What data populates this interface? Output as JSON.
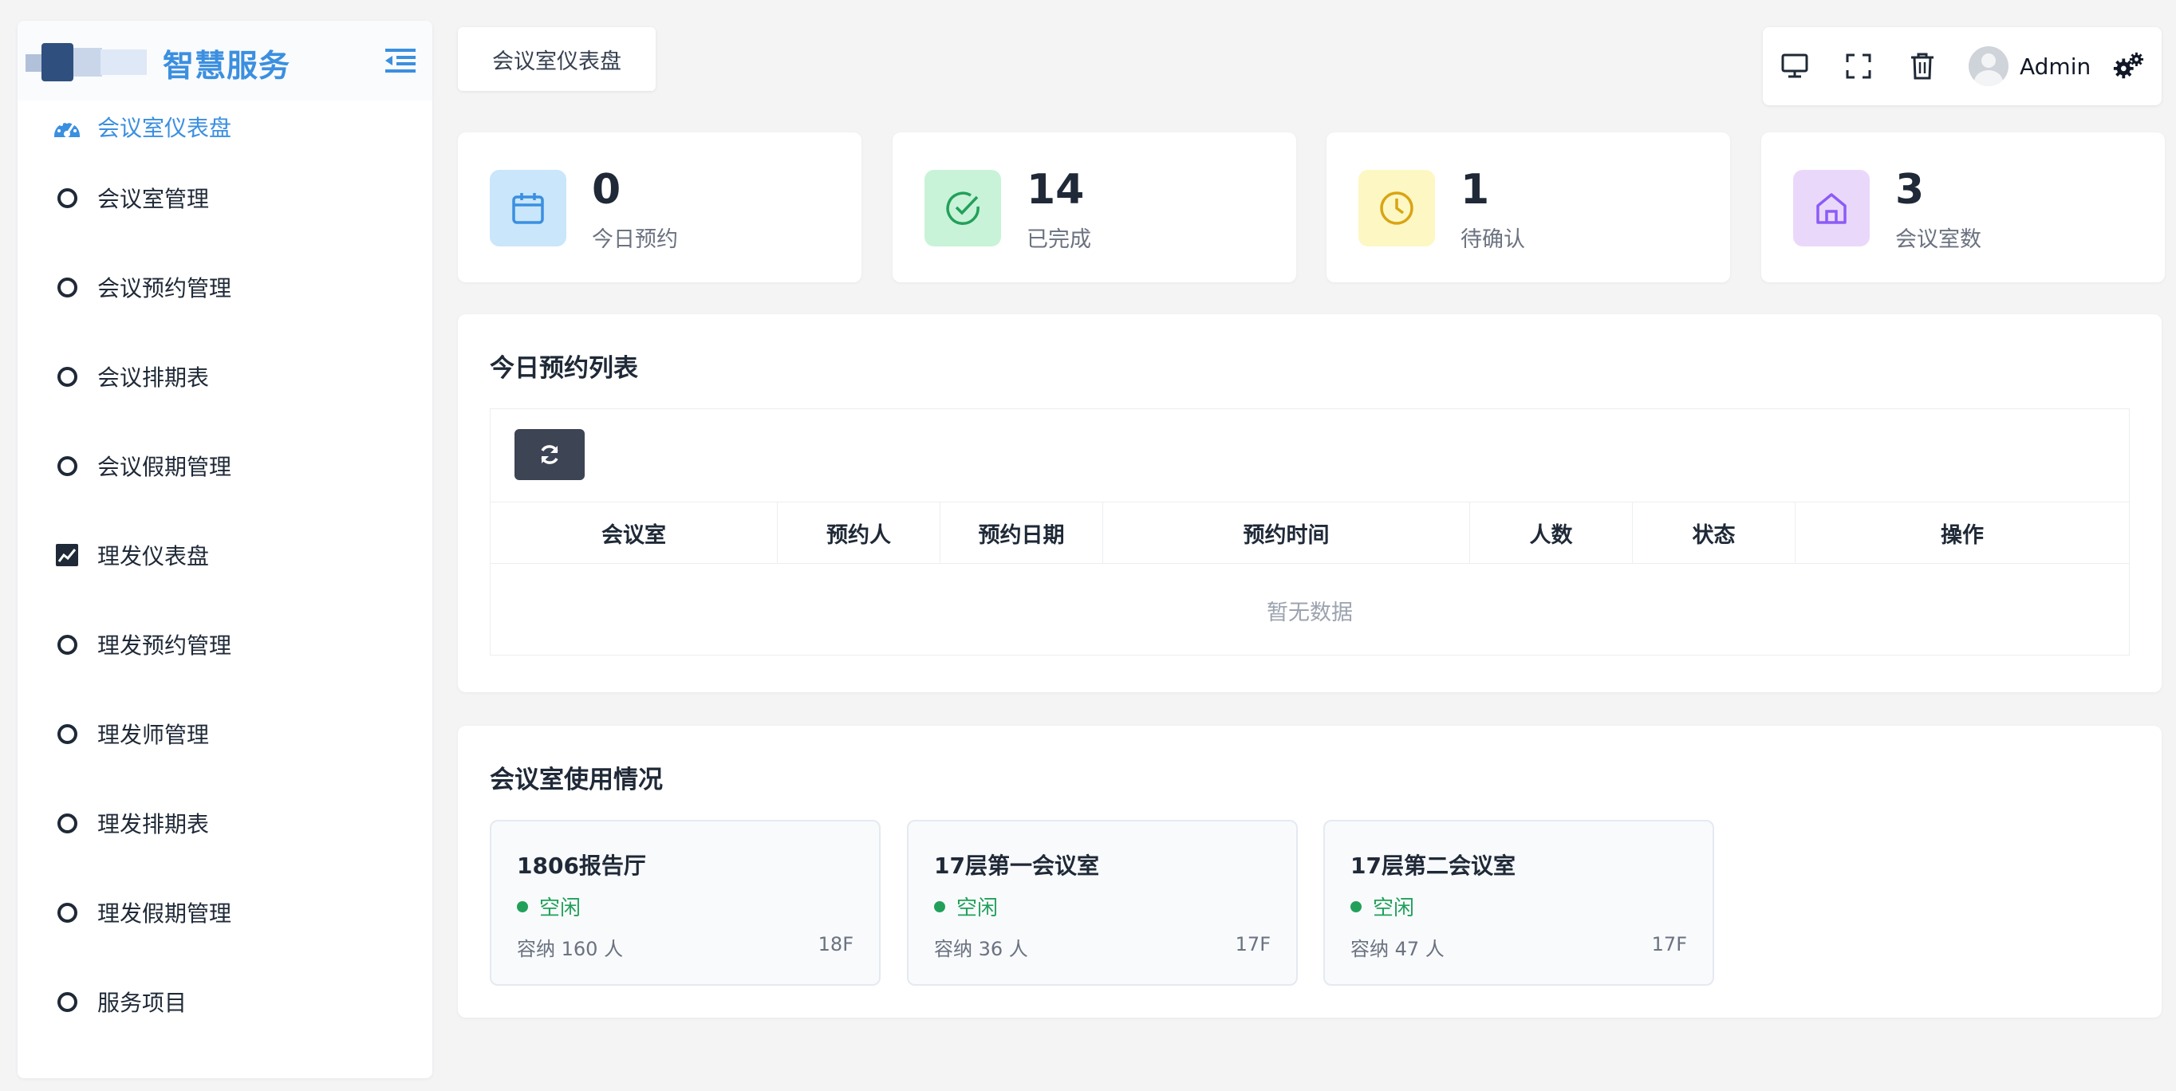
{
  "brand": {
    "title": "智慧服务"
  },
  "sidebar": {
    "items": [
      {
        "label": "会议室仪表盘",
        "icon": "dashboard-gauge-icon",
        "active": true
      },
      {
        "label": "会议室管理",
        "icon": "circle-icon"
      },
      {
        "label": "会议预约管理",
        "icon": "circle-icon"
      },
      {
        "label": "会议排期表",
        "icon": "circle-icon"
      },
      {
        "label": "会议假期管理",
        "icon": "circle-icon"
      },
      {
        "label": "理发仪表盘",
        "icon": "chart-line-icon"
      },
      {
        "label": "理发预约管理",
        "icon": "circle-icon"
      },
      {
        "label": "理发师管理",
        "icon": "circle-icon"
      },
      {
        "label": "理发排期表",
        "icon": "circle-icon"
      },
      {
        "label": "理发假期管理",
        "icon": "circle-icon"
      },
      {
        "label": "服务项目",
        "icon": "circle-icon"
      }
    ]
  },
  "tab": {
    "label": "会议室仪表盘"
  },
  "toolbar": {
    "user_name": "Admin"
  },
  "stats": [
    {
      "value": "0",
      "label": "今日预约",
      "icon": "calendar-icon",
      "bg": "#c9e6fb",
      "color": "#3b8fe0"
    },
    {
      "value": "14",
      "label": "已完成",
      "icon": "check-circle-icon",
      "bg": "#c8f3d8",
      "color": "#22a05a"
    },
    {
      "value": "1",
      "label": "待确认",
      "icon": "clock-icon",
      "bg": "#fdf7c3",
      "color": "#d9a414"
    },
    {
      "value": "3",
      "label": "会议室数",
      "icon": "home-icon",
      "bg": "#ead8fb",
      "color": "#8b5cf6"
    }
  ],
  "today_list": {
    "title": "今日预约列表",
    "columns": [
      "会议室",
      "预约人",
      "预约日期",
      "预约时间",
      "人数",
      "状态",
      "操作"
    ],
    "empty_text": "暂无数据"
  },
  "room_usage": {
    "title": "会议室使用情况",
    "rooms": [
      {
        "name": "1806报告厅",
        "status": "空闲",
        "capacity": "容纳 160 人",
        "floor": "18F"
      },
      {
        "name": "17层第一会议室",
        "status": "空闲",
        "capacity": "容纳 36 人",
        "floor": "17F"
      },
      {
        "name": "17层第二会议室",
        "status": "空闲",
        "capacity": "容纳 47 人",
        "floor": "17F"
      }
    ]
  }
}
